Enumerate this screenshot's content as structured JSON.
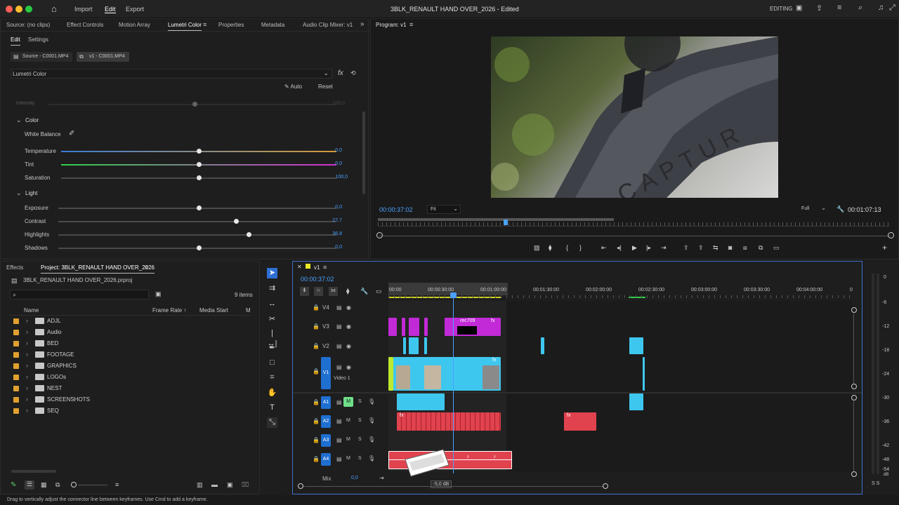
{
  "app": {
    "title": "3BLK_RENAULT HAND OVER_2026",
    "status": "- Edited",
    "workspace": "EDITING",
    "menu": [
      "Import",
      "Edit",
      "Export"
    ],
    "active_menu": "Edit"
  },
  "top_panel_tabs": [
    "Source: (no clips)",
    "Effect Controls",
    "Motion Array",
    "Lumetri Color",
    "Properties",
    "Metadata",
    "Audio Clip Mixer: v1"
  ],
  "active_tab": "Lumetri Color",
  "lumetri": {
    "subtabs": [
      "Edit",
      "Settings"
    ],
    "source_button": "Source - C0001.MP4",
    "seq_button": "v1 - C0001.MP4",
    "effect_name": "Lumetri Color",
    "auto_label": "Auto",
    "reset_label": "Reset",
    "intensity": {
      "label": "Intensity",
      "value": "100,0"
    },
    "color_section": "Color",
    "white_balance": "White Balance",
    "sliders": [
      {
        "label": "Temperature",
        "value": "0,0",
        "pos": 0.5
      },
      {
        "label": "Tint",
        "value": "0,0",
        "pos": 0.5
      },
      {
        "label": "Saturation",
        "value": "100,0",
        "pos": 0.5
      }
    ],
    "light_section": "Light",
    "light_sliders": [
      {
        "label": "Exposure",
        "value": "0,0",
        "pos": 0.5
      },
      {
        "label": "Contrast",
        "value": "27,7",
        "pos": 0.64
      },
      {
        "label": "Highlights",
        "value": "36,8",
        "pos": 0.68
      },
      {
        "label": "Shadows",
        "value": "0,0",
        "pos": 0.5
      }
    ]
  },
  "program": {
    "tab": "Program: v1",
    "timecode": "00:00:37:02",
    "fit": "Fit",
    "quality": "Full",
    "duration": "00:01:07:13",
    "playhead": 0.34,
    "image_text": "CAPTUR"
  },
  "project": {
    "tabs": [
      "Effects",
      "Project: 3BLK_RENAULT HAND OVER_2026"
    ],
    "file": "3BLK_RENAULT HAND OVER_2026.prproj",
    "items_count": "9 items",
    "search_placeholder": "",
    "columns": [
      "Name",
      "Frame Rate",
      "Media Start",
      "M"
    ],
    "folders": [
      "ADJL",
      "Audio",
      "BED",
      "FOOTAGE",
      "GRAPHICS",
      "LOGOs",
      "NEST",
      "SCREENSHOTS",
      "SEQ"
    ]
  },
  "timeline": {
    "seq_name": "v1",
    "timecode": "00:00:37:02",
    "ruler": [
      "00:00",
      "00:00:30:00",
      "00:01:00:00",
      "00:01:30:00",
      "00:02:00:00",
      "00:02:30:00",
      "00:03:00:00",
      "00:03:30:00",
      "00:04:00:00",
      "0"
    ],
    "video_tracks": [
      "V4",
      "V3",
      "V2",
      "V1"
    ],
    "v1_name": "Video 1",
    "audio_tracks": [
      "A1",
      "A2",
      "A3",
      "A4"
    ],
    "mix_label": "Mix",
    "mix_value": "0,0",
    "clip_label": "rec709",
    "fx": "fx",
    "db_tooltip": "-5,0 dB",
    "m_label": "M",
    "s_label": "S",
    "meter_scale": [
      "0",
      "-6",
      "-12",
      "-18",
      "-24",
      "-30",
      "-36",
      "-42",
      "-48",
      "-54",
      "dB"
    ],
    "meter_bottom": "S S"
  },
  "status_bar": "Drag to vertically adjust the connector line between keyframes. Use Cmd to add a keyframe.",
  "colors": {
    "accent": "#4aa1ff",
    "magenta": "#c12ad6",
    "cyan": "#3ec7ee",
    "audio": "#e0424e",
    "folder": "#e0a030"
  }
}
